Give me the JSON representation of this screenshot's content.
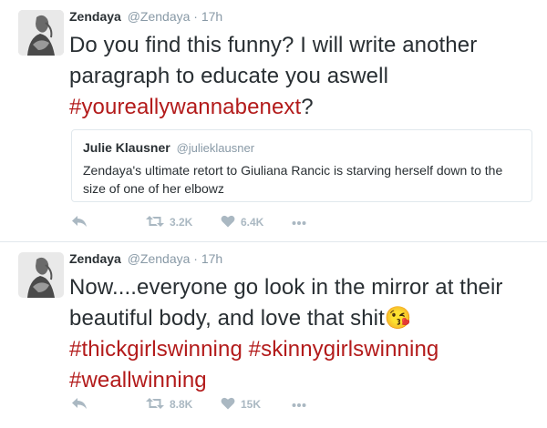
{
  "colors": {
    "hashtag": "#b31b1b",
    "text": "#292f33",
    "muted": "#8899a6",
    "action": "#aab8c2",
    "divider": "#e1e8ed"
  },
  "tweets": [
    {
      "name": "Zendaya",
      "handle": "@Zendaya",
      "dot": "·",
      "time": "17h",
      "text_1": "Do you find this funny? I will write another paragraph to educate you aswell ",
      "hashtag_1": "#youreallywannabenext",
      "text_2": "?",
      "quote": {
        "name": "Julie Klausner",
        "handle": "@julieklausner",
        "text": "Zendaya's ultimate retort to Giuliana Rancic is starving herself down to the size of one of her elbowz"
      },
      "actions": {
        "reply_icon": "reply-icon",
        "retweets": "3.2K",
        "likes": "6.4K",
        "more_icon": "more-icon"
      }
    },
    {
      "name": "Zendaya",
      "handle": "@Zendaya",
      "dot": "·",
      "time": "17h",
      "text_1": "Now....everyone go look in the mirror at their beautiful body, and love that shit",
      "emoji": "😘",
      "hashtag_1": "#thickgirlswinning",
      "hashtag_2": "#skinnygirlswinning",
      "hashtag_3": "#weallwinning",
      "actions": {
        "reply_icon": "reply-icon",
        "retweets": "8.8K",
        "likes": "15K",
        "more_icon": "more-icon"
      }
    }
  ]
}
